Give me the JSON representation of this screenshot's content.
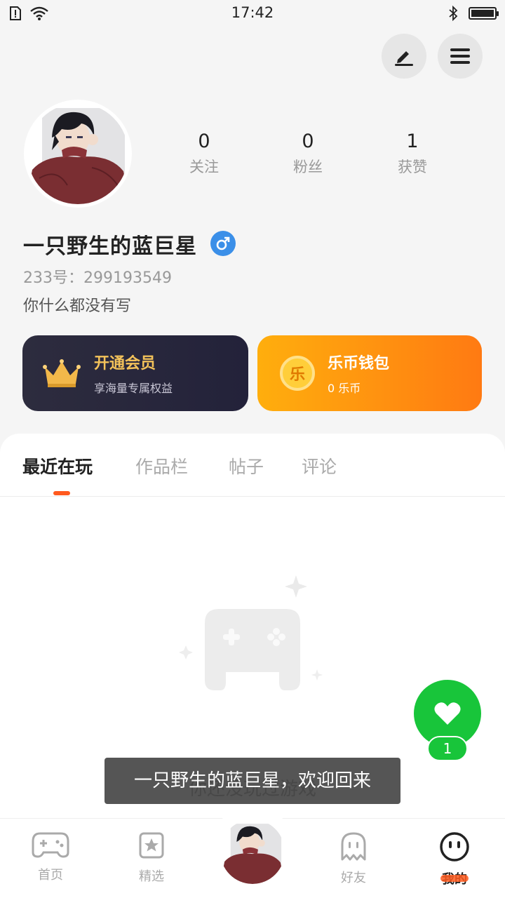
{
  "status_bar": {
    "time": "17:42"
  },
  "profile": {
    "stats": [
      {
        "value": "0",
        "label": "关注"
      },
      {
        "value": "0",
        "label": "粉丝"
      },
      {
        "value": "1",
        "label": "获赞"
      }
    ],
    "username": "一只野生的蓝巨星",
    "gender": "♂",
    "uid_line": "233号：299193549",
    "bio": "你什么都没有写"
  },
  "cards": {
    "vip": {
      "title": "开通会员",
      "subtitle": "享海量专属权益"
    },
    "wallet": {
      "title": "乐币钱包",
      "subtitle": "0 乐币",
      "coin_glyph": "乐"
    }
  },
  "tabs": [
    {
      "label": "最近在玩",
      "active": true
    },
    {
      "label": "作品栏",
      "active": false
    },
    {
      "label": "帖子",
      "active": false
    },
    {
      "label": "评论",
      "active": false
    }
  ],
  "empty_state": {
    "text": "你还没玩过游戏"
  },
  "like_fab": {
    "count": "1"
  },
  "toast": {
    "text": "一只野生的蓝巨星，欢迎回来"
  },
  "bottom_nav": [
    {
      "label": "首页",
      "icon": "gamepad-icon"
    },
    {
      "label": "精选",
      "icon": "star-bookmark-icon"
    },
    {
      "label": "",
      "icon": "avatar"
    },
    {
      "label": "好友",
      "icon": "ghost-icon"
    },
    {
      "label": "我的",
      "icon": "smiley-face-icon"
    }
  ],
  "colors": {
    "accent": "#ff5a1f",
    "like_green": "#18c53a",
    "vip_gold": "#f3c25a",
    "wallet_orange": "#ff8a12",
    "gender_blue": "#3b8fe8"
  }
}
